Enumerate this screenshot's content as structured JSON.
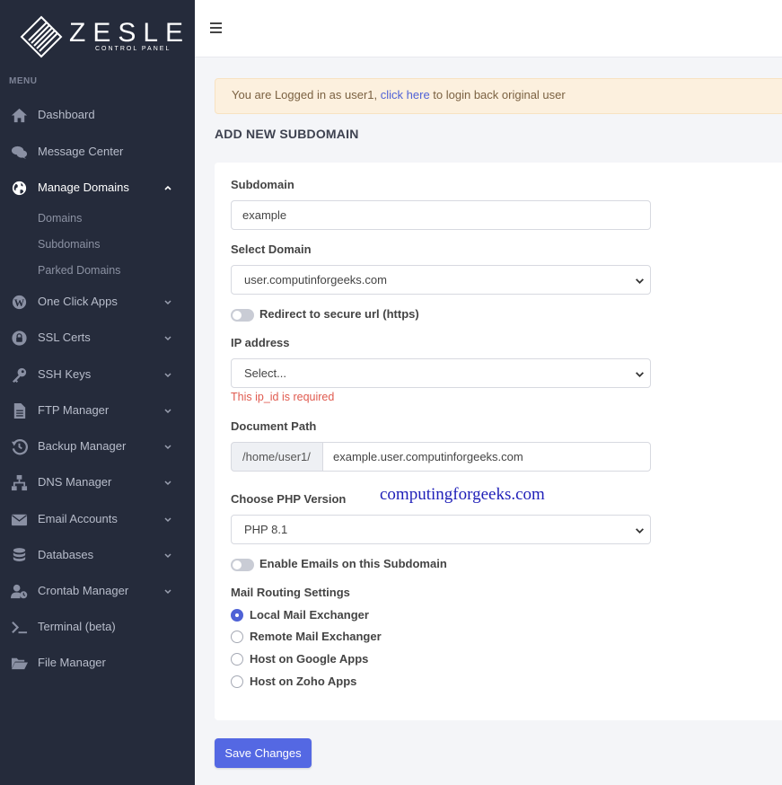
{
  "brand": {
    "name": "ZESLE",
    "subtitle": "CONTROL PANEL"
  },
  "sidebar": {
    "menu_title": "MENU",
    "items": [
      {
        "label": "Dashboard",
        "icon": "home-icon"
      },
      {
        "label": "Message Center",
        "icon": "chat-icon"
      },
      {
        "label": "Manage Domains",
        "icon": "globe-icon",
        "expanded": true,
        "children": [
          {
            "label": "Domains"
          },
          {
            "label": "Subdomains"
          },
          {
            "label": "Parked Domains"
          }
        ]
      },
      {
        "label": "One Click Apps",
        "icon": "wordpress-icon"
      },
      {
        "label": "SSL Certs",
        "icon": "lock-icon"
      },
      {
        "label": "SSH Keys",
        "icon": "key-icon"
      },
      {
        "label": "FTP Manager",
        "icon": "file-icon"
      },
      {
        "label": "Backup Manager",
        "icon": "history-icon"
      },
      {
        "label": "DNS Manager",
        "icon": "network-icon"
      },
      {
        "label": "Email Accounts",
        "icon": "envelope-icon"
      },
      {
        "label": "Databases",
        "icon": "database-icon"
      },
      {
        "label": "Crontab Manager",
        "icon": "user-clock-icon"
      },
      {
        "label": "Terminal (beta)",
        "icon": "terminal-icon"
      },
      {
        "label": "File Manager",
        "icon": "folder-open-icon"
      }
    ]
  },
  "alert": {
    "prefix": "You are Logged in as user1, ",
    "link": "click here",
    "suffix": " to login back original user"
  },
  "page_title": "ADD NEW SUBDOMAIN",
  "form": {
    "subdomain_label": "Subdomain",
    "subdomain_value": "example",
    "domain_label": "Select Domain",
    "domain_value": "user.computinforgeeks.com",
    "redirect_label": "Redirect to secure url (https)",
    "ip_label": "IP address",
    "ip_value": "Select...",
    "ip_error": "This ip_id is required",
    "docpath_label": "Document Path",
    "docpath_prefix": "/home/user1/",
    "docpath_value": "example.user.computinforgeeks.com",
    "php_label": "Choose PHP Version",
    "php_value": "PHP 8.1",
    "emails_label": "Enable Emails on this Subdomain",
    "mail_routing_label": "Mail Routing Settings",
    "mail_options": [
      {
        "label": "Local Mail Exchanger",
        "checked": true
      },
      {
        "label": "Remote Mail Exchanger",
        "checked": false
      },
      {
        "label": "Host on Google Apps",
        "checked": false
      },
      {
        "label": "Host on Zoho Apps",
        "checked": false
      }
    ],
    "save_label": "Save Changes"
  },
  "watermark": "computingforgeeks.com",
  "colors": {
    "sidebar_bg": "#252b3b",
    "accent": "#5468e3",
    "error": "#e05a4f",
    "alert_bg": "#fcf0de"
  }
}
